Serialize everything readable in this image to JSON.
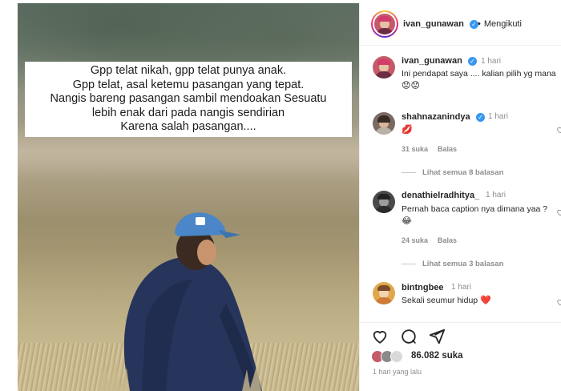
{
  "photo": {
    "caption_lines": [
      "Gpp telat nikah, gpp telat punya anak.",
      "Gpp telat, asal ketemu pasangan yang tepat.",
      "Nangis bareng pasangan sambil mendoakan Sesuatu",
      "lebih enak dari pada nangis sendirian",
      "Karena salah pasangan...."
    ]
  },
  "header": {
    "username": "ivan_gunawan",
    "follow_status": "Mengikuti"
  },
  "post_caption": {
    "username": "ivan_gunawan",
    "time": "1 hari",
    "text": "Ini pendapat saya .... kalian pilih yg mana",
    "emoji": "😟😟"
  },
  "comments": [
    {
      "username": "shahnazanindya",
      "verified": true,
      "time": "1 hari",
      "text": "",
      "emoji": "💋",
      "likes": "31 suka",
      "reply_label": "Balas",
      "view_replies": "Lihat semua 8 balasan"
    },
    {
      "username": "denathielradhitya_",
      "verified": false,
      "time": "1 hari",
      "text": "Pernah baca caption nya dimana yaa ?",
      "emoji": "😂",
      "likes": "24 suka",
      "reply_label": "Balas",
      "view_replies": "Lihat semua 3 balasan"
    },
    {
      "username": "bintngbee",
      "verified": false,
      "time": "1 hari",
      "text": "Sekali seumur hidup",
      "emoji": "❤️"
    }
  ],
  "footer": {
    "likes_count": "86.082 suka",
    "posted_time": "1 hari yang lalu"
  },
  "icons": {
    "like": "heart-icon",
    "comment": "comment-icon",
    "share": "share-icon",
    "verified": "verified-badge-icon"
  },
  "colors": {
    "verified_blue": "#3897f0",
    "muted_text": "#8e8e8e",
    "heart_red": "#ed4956"
  }
}
